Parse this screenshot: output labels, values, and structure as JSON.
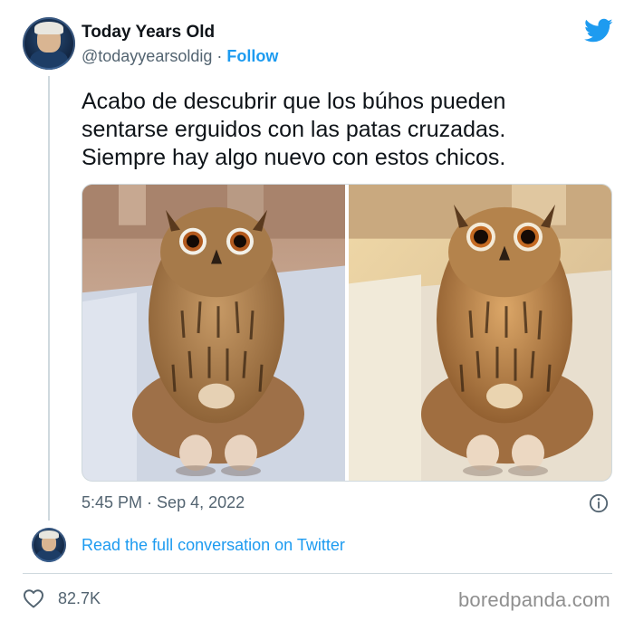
{
  "author": {
    "display_name": "Today Years Old",
    "handle": "@todayyearsoldig",
    "separator": " · ",
    "follow_label": "Follow"
  },
  "tweet": {
    "lines": [
      "Acabo de descubrir que los búhos pueden",
      "sentarse erguidos con las patas cruzadas.",
      "Siempre hay algo nuevo con estos chicos."
    ],
    "time": "5:45 PM",
    "date_separator": " · ",
    "date": "Sep 4, 2022"
  },
  "thread": {
    "read_label": "Read the full conversation on Twitter"
  },
  "engagement": {
    "likes": "82.7K"
  },
  "watermark": "boredpanda.com",
  "icons": {
    "brand": "twitter-bird-icon",
    "info": "info-icon",
    "like": "heart-icon"
  },
  "colors": {
    "accent": "#1d9bf0",
    "text_primary": "#0f1419",
    "text_secondary": "#536471",
    "border": "#cfd9de"
  }
}
